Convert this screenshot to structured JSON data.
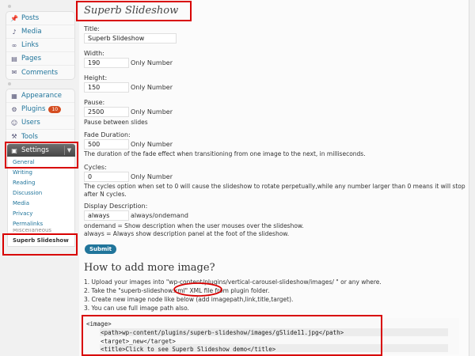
{
  "sidebar": {
    "group1": [
      {
        "label": "Posts",
        "icon": "pin-icon"
      },
      {
        "label": "Media",
        "icon": "media-icon"
      },
      {
        "label": "Links",
        "icon": "link-icon"
      },
      {
        "label": "Pages",
        "icon": "page-icon"
      },
      {
        "label": "Comments",
        "icon": "comment-icon"
      }
    ],
    "group2": [
      {
        "label": "Appearance",
        "icon": "appearance-icon"
      },
      {
        "label": "Plugins",
        "icon": "plugin-icon",
        "badge": "10"
      },
      {
        "label": "Users",
        "icon": "users-icon"
      },
      {
        "label": "Tools",
        "icon": "tools-icon"
      }
    ],
    "settings_label": "Settings",
    "submenu": [
      "General",
      "Writing",
      "Reading",
      "Discussion",
      "Media",
      "Privacy",
      "Permalinks",
      "Miscellaneous"
    ],
    "current": "Superb Slideshow"
  },
  "main": {
    "page_title": "Superb Slideshow",
    "title_label": "Title:",
    "title_value": "Superb Slideshow",
    "width_label": "Width:",
    "width_value": "190",
    "height_label": "Height:",
    "height_value": "150",
    "pause_label": "Pause:",
    "pause_value": "2500",
    "pause_desc": "Pause between slides",
    "fade_label": "Fade Duration:",
    "fade_value": "500",
    "fade_desc": "The duration of the fade effect when transitioning from one image to the next, in milliseconds.",
    "cycles_label": "Cycles:",
    "cycles_value": "0",
    "cycles_desc_1": "The cycles option when set to 0 will cause the slideshow to rotate perpetually,while any number larger than 0 means it will stop",
    "cycles_desc_2": "after N cycles.",
    "display_label": "Display Description:",
    "display_value": "always",
    "display_hint": "always/ondemand",
    "display_desc_1": "ondemand = Show description when the user mouses over the slideshow.",
    "display_desc_2": "always = Always show description panel at the foot of the slideshow.",
    "only_number": "Only Number",
    "submit_label": "Submit",
    "howto_title": "How to add more image?",
    "steps": [
      "1. Upload your images into \"wp-content/plugins/vertical-carousel-slideshow/images/ \" or any where.",
      "2. Take the \"superb-slideshow.xml\" XML file from plugin folder.",
      "3. Create new image node like below (add imagepath,link,title,target).",
      "3. You can use full image path also."
    ],
    "code_lines": [
      "<image>",
      "    <path>wp-content/plugins/superb-slideshow/images/gSlide11.jpg</path>",
      "    <target>_new</target>",
      "    <title>Click to see Superb Slideshow demo</title>"
    ]
  },
  "colors": {
    "link": "#21759b",
    "annotation_red": "#d80000",
    "settings_header": "#464646",
    "badge": "#d54e21"
  }
}
